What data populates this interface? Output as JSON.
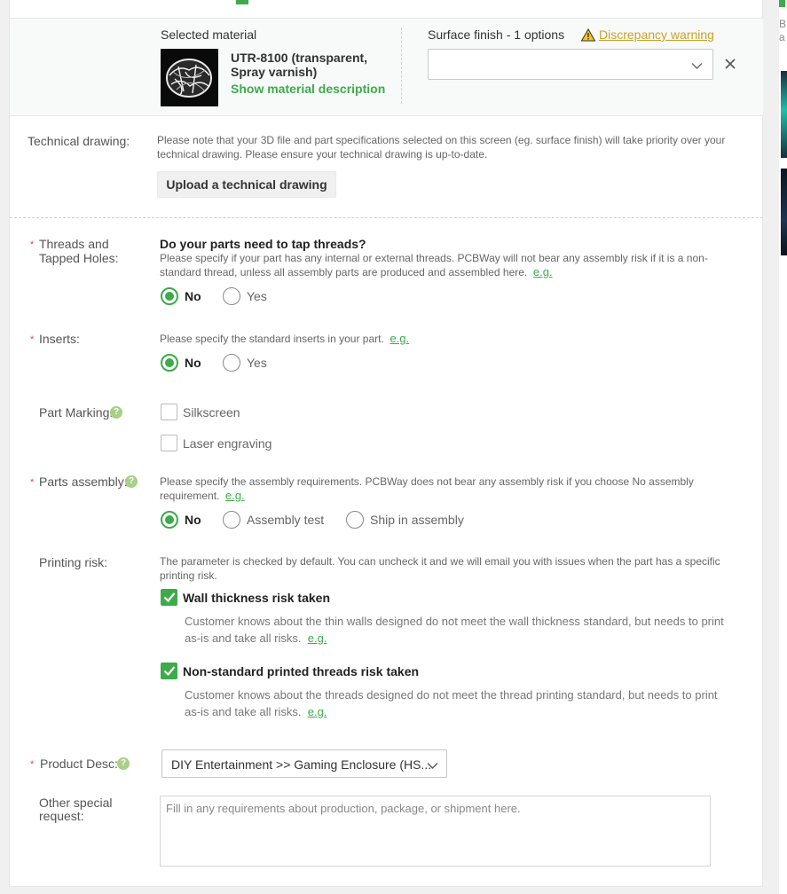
{
  "material": {
    "selected_label": "Selected material",
    "name_line1": "UTR-8100 (transparent,",
    "name_line2": "Spray varnish)",
    "show_desc": "Show material description",
    "surface_label": "Surface finish - 1 options",
    "warning_text": "Discrepancy warning",
    "surface_value": ""
  },
  "tech": {
    "label": "Technical drawing:",
    "note_line1": "Please note that your 3D file and part specifications selected on this screen (eg. surface finish) will take priority over your",
    "note_line2": "technical drawing. Please ensure your technical drawing is up-to-date.",
    "upload_button": "Upload a technical drawing"
  },
  "threads": {
    "label_line1": "Threads and",
    "label_line2": "Tapped Holes:",
    "question": "Do your parts need to tap threads?",
    "desc_line1": "Please specify if your part has any internal or external threads. PCBWay will not bear any assembly risk if it is a non-",
    "desc_line2": "standard thread, unless all assembly parts are produced and assembled here.",
    "eg": "e.g.",
    "options": [
      "No",
      "Yes"
    ],
    "selected": "No"
  },
  "inserts": {
    "label": "Inserts:",
    "desc": "Please specify the standard inserts in your part.",
    "eg": "e.g.",
    "options": [
      "No",
      "Yes"
    ],
    "selected": "No"
  },
  "marking": {
    "label": "Part Marking:",
    "options": [
      "Silkscreen",
      "Laser engraving"
    ]
  },
  "assembly": {
    "label": "Parts assembly:",
    "desc_line1": "Please specify the assembly requirements. PCBWay does not bear any assembly risk if you choose No assembly",
    "desc_line2": "requirement.",
    "eg": "e.g.",
    "options": [
      "No",
      "Assembly test",
      "Ship in assembly"
    ],
    "selected": "No"
  },
  "printing_risk": {
    "label": "Printing risk:",
    "desc_line1": "The parameter is checked by default. You can uncheck it and we will email you with issues when the part has a specific",
    "desc_line2": "printing risk.",
    "items": [
      {
        "title": "Wall thickness risk taken",
        "desc_line1": "Customer knows about the thin walls designed do not meet the wall thickness standard, but needs to print",
        "desc_line2": "as-is and take all risks.",
        "eg": "e.g.",
        "checked": true
      },
      {
        "title": "Non-standard printed threads risk taken",
        "desc_line1": "Customer knows about the threads designed do not meet the thread printing standard, but needs to print",
        "desc_line2": "as-is and take all risks.",
        "eg": "e.g.",
        "checked": true
      }
    ]
  },
  "product": {
    "label": "Product Desc:",
    "value": "DIY Entertainment >> Gaming Enclosure (HS..."
  },
  "special": {
    "label_line1": "Other special",
    "label_line2": "request:",
    "placeholder": "Fill in any requirements about production, package, or shipment here."
  },
  "sidebar": {
    "line1": "B",
    "line2": "a"
  },
  "colors": {
    "accent": "#3dab4a",
    "warning": "#c9a32b",
    "required": "#e64545"
  }
}
